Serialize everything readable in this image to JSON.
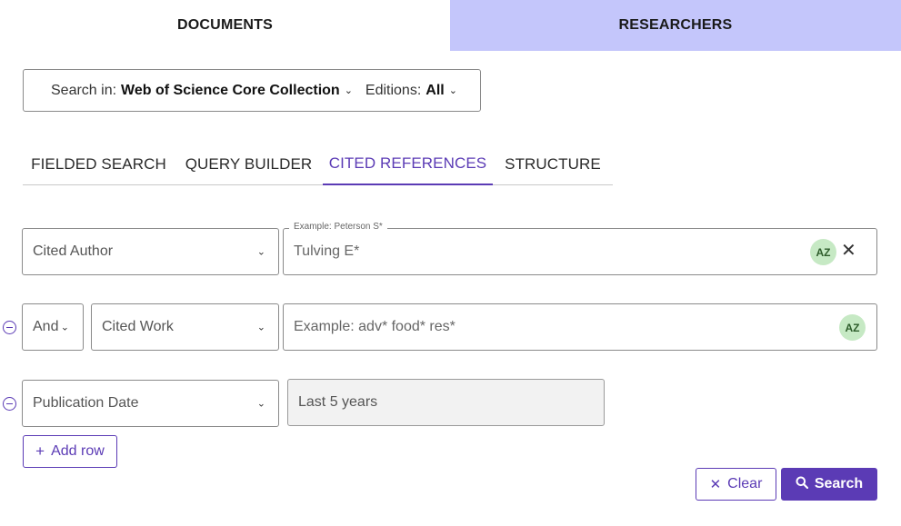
{
  "top_tabs": {
    "documents": "DOCUMENTS",
    "researchers": "RESEARCHERS"
  },
  "search_in": {
    "label": "Search in:",
    "value": "Web of Science Core Collection",
    "editions_label": "Editions:",
    "editions_value": "All"
  },
  "sub_tabs": {
    "fielded": "FIELDED SEARCH",
    "query_builder": "QUERY BUILDER",
    "cited_references": "CITED REFERENCES",
    "structure": "STRUCTURE"
  },
  "rows": [
    {
      "field": "Cited Author",
      "legend": "Example: Peterson S*",
      "value": "Tulving E*"
    },
    {
      "operator": "And",
      "field": "Cited Work",
      "placeholder": "Example: adv* food* res*"
    },
    {
      "field": "Publication Date",
      "value": "Last 5 years"
    }
  ],
  "az_label": "AZ",
  "add_row": "Add row",
  "buttons": {
    "clear": "Clear",
    "search": "Search"
  },
  "colors": {
    "accent": "#5b3bb5",
    "researchers_tab_bg": "#c4c6fb",
    "az_badge": "#c6e9c4"
  }
}
